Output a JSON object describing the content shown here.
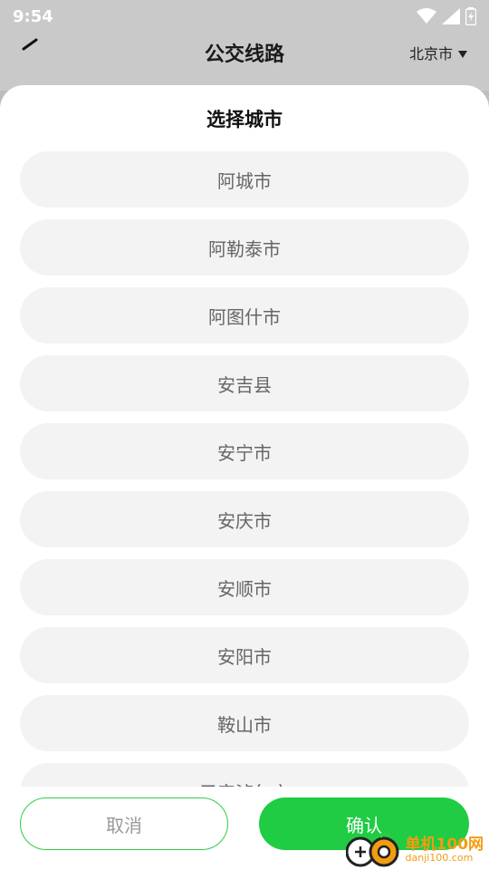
{
  "status_bar": {
    "time": "9:54"
  },
  "app_bar": {
    "title": "公交线路",
    "city": "北京市"
  },
  "sheet": {
    "title": "选择城市",
    "cities": [
      "阿城市",
      "阿勒泰市",
      "阿图什市",
      "安吉县",
      "安宁市",
      "安庆市",
      "安顺市",
      "安阳市",
      "鞍山市",
      "巴彦淖尔市"
    ],
    "cancel_label": "取消",
    "confirm_label": "确认"
  },
  "watermark": {
    "name": "单机100网",
    "url": "danji100.com"
  },
  "colors": {
    "accent": "#1fcc43",
    "item_bg": "#f3f3f3",
    "overlay": "#c9c9c9"
  }
}
